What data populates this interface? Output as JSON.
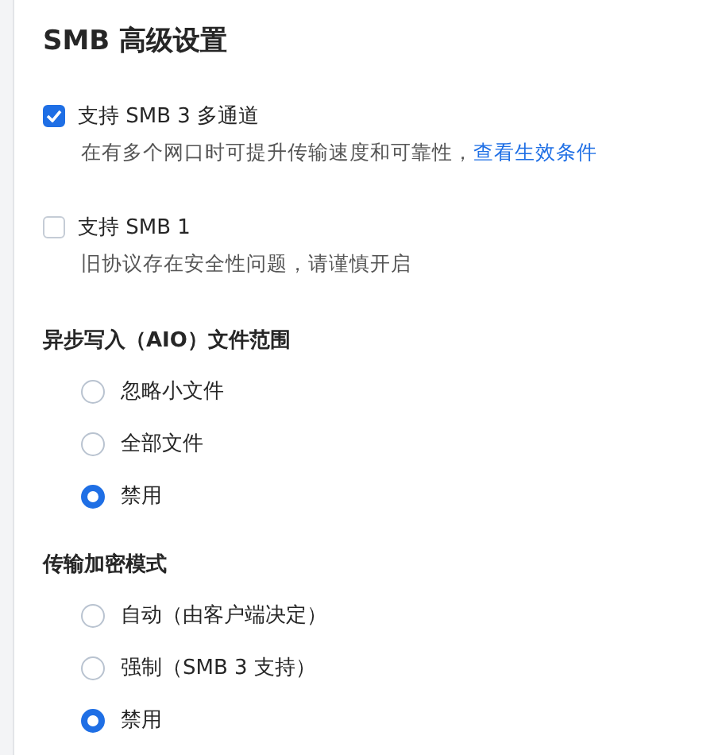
{
  "title": "SMB 高级设置",
  "checkboxes": [
    {
      "label": "支持 SMB 3 多通道",
      "checked": true,
      "description": "在有多个网口时可提升传输速度和可靠性，",
      "link": "查看生效条件"
    },
    {
      "label": "支持 SMB 1",
      "checked": false,
      "description": "旧协议存在安全性问题，请谨慎开启"
    }
  ],
  "groups": [
    {
      "heading": "异步写入（AIO）文件范围",
      "options": [
        {
          "label": "忽略小文件",
          "selected": false
        },
        {
          "label": "全部文件",
          "selected": false
        },
        {
          "label": "禁用",
          "selected": true
        }
      ]
    },
    {
      "heading": "传输加密模式",
      "options": [
        {
          "label": "自动（由客户端决定）",
          "selected": false
        },
        {
          "label": "强制（SMB 3 支持）",
          "selected": false
        },
        {
          "label": "禁用",
          "selected": true
        }
      ]
    }
  ]
}
